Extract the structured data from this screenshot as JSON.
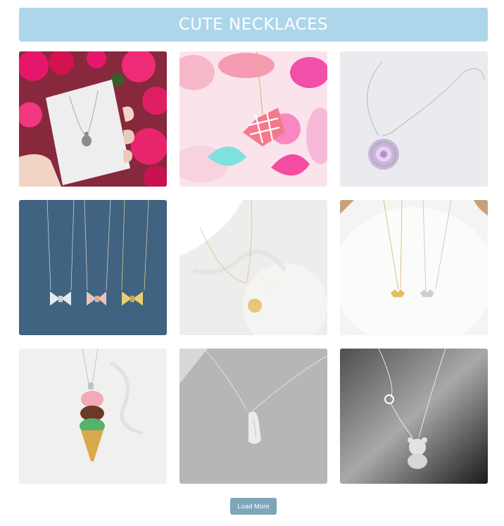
{
  "header": {
    "title": "CUTE NECKLACES"
  },
  "colors": {
    "header_bg": "#add6ea",
    "button_bg": "#7fa5b9",
    "text_light": "#ffffff"
  },
  "gallery": {
    "items": [
      {
        "subject": "turtle pendant on card"
      },
      {
        "subject": "pink waffle heart pendant"
      },
      {
        "subject": "lilac mandala pendant"
      },
      {
        "subject": "three bow tie necklaces"
      },
      {
        "subject": "initial disc and pearl"
      },
      {
        "subject": "gold and silver bat necklaces"
      },
      {
        "subject": "ice cream cone pendant"
      },
      {
        "subject": "silver bean pendant"
      },
      {
        "subject": "teddy bear pendant"
      }
    ]
  },
  "footer": {
    "load_more_label": "Load More"
  }
}
